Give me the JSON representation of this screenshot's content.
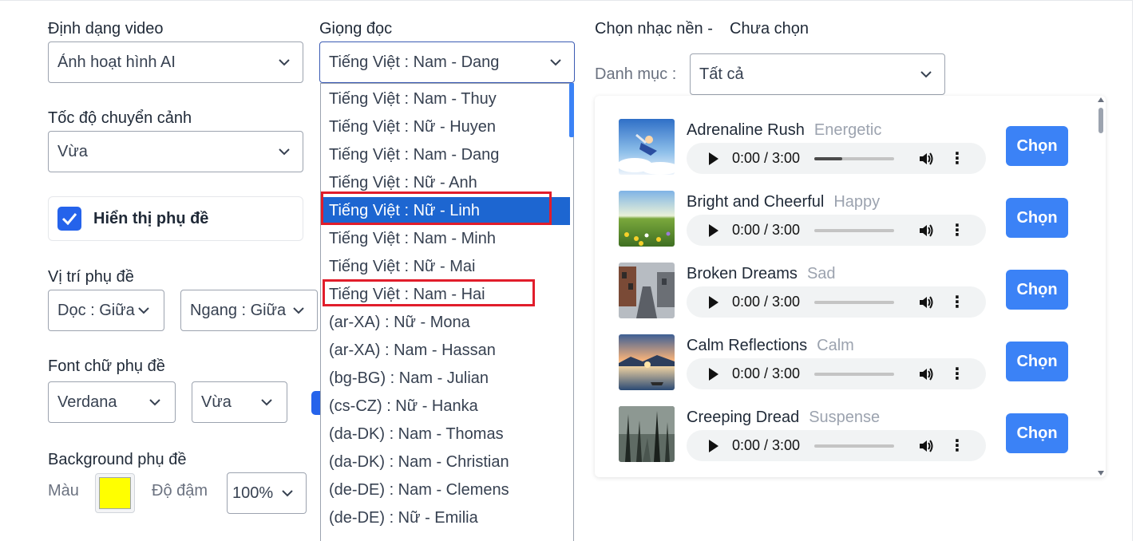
{
  "labels": {
    "video_format": "Định dạng video",
    "voice": "Giọng đọc",
    "music": "Chọn nhạc nền -",
    "music_status": "Chưa chọn",
    "category": "Danh mục :",
    "transition_speed": "Tốc độ chuyển cảnh",
    "show_subtitles": "Hiển thị phụ đề",
    "subtitle_position": "Vị trí phụ đề",
    "subtitle_font": "Font chữ phụ đề",
    "subtitle_background": "Background phụ đề",
    "color": "Màu",
    "opacity": "Độ đậm"
  },
  "selects": {
    "video_format": "Ảnh hoạt hình AI",
    "voice": "Tiếng Việt : Nam - Dang",
    "category": "Tất cả",
    "transition_speed": "Vừa",
    "vertical_position": "Dọc : Giữa",
    "horizontal_position": "Ngang : Giữa",
    "font": "Verdana",
    "font_size": "Vừa",
    "opacity": "100%"
  },
  "subtitle_background_color": "#ffff00",
  "voice_options": [
    "Tiếng Việt : Nam - Thuy",
    "Tiếng Việt : Nữ - Huyen",
    "Tiếng Việt : Nam - Dang",
    "Tiếng Việt : Nữ - Anh",
    "Tiếng Việt : Nữ - Linh",
    "Tiếng Việt : Nam - Minh",
    "Tiếng Việt : Nữ - Mai",
    "Tiếng Việt : Nam - Hai",
    "(ar-XA) : Nữ - Mona",
    "(ar-XA) : Nam - Hassan",
    "(bg-BG) : Nam - Julian",
    "(cs-CZ) : Nữ - Hanka",
    "(da-DK) : Nam - Thomas",
    "(da-DK) : Nam - Christian",
    "(de-DE) : Nam - Clemens",
    "(de-DE) : Nữ - Emilia"
  ],
  "tracks": [
    {
      "title": "Adrenaline Rush",
      "mood": "Energetic",
      "time": "0:00 / 3:00",
      "progress": 0.35,
      "button": "Chọn",
      "thumb": "sky-diver"
    },
    {
      "title": "Bright and Cheerful",
      "mood": "Happy",
      "time": "0:00 / 3:00",
      "progress": 0,
      "button": "Chọn",
      "thumb": "flower-meadow"
    },
    {
      "title": "Broken Dreams",
      "mood": "Sad",
      "time": "0:00 / 3:00",
      "progress": 0,
      "button": "Chọn",
      "thumb": "ruined-street"
    },
    {
      "title": "Calm Reflections",
      "mood": "Calm",
      "time": "0:00 / 3:00",
      "progress": 0,
      "button": "Chọn",
      "thumb": "sunset-lake"
    },
    {
      "title": "Creeping Dread",
      "mood": "Suspense",
      "time": "0:00 / 3:00",
      "progress": 0,
      "button": "Chọn",
      "thumb": "dark-forest"
    }
  ],
  "colors": {
    "accent": "#3b82f6",
    "selected_option": "#1d66d1",
    "highlight_box": "#e11d2b"
  }
}
